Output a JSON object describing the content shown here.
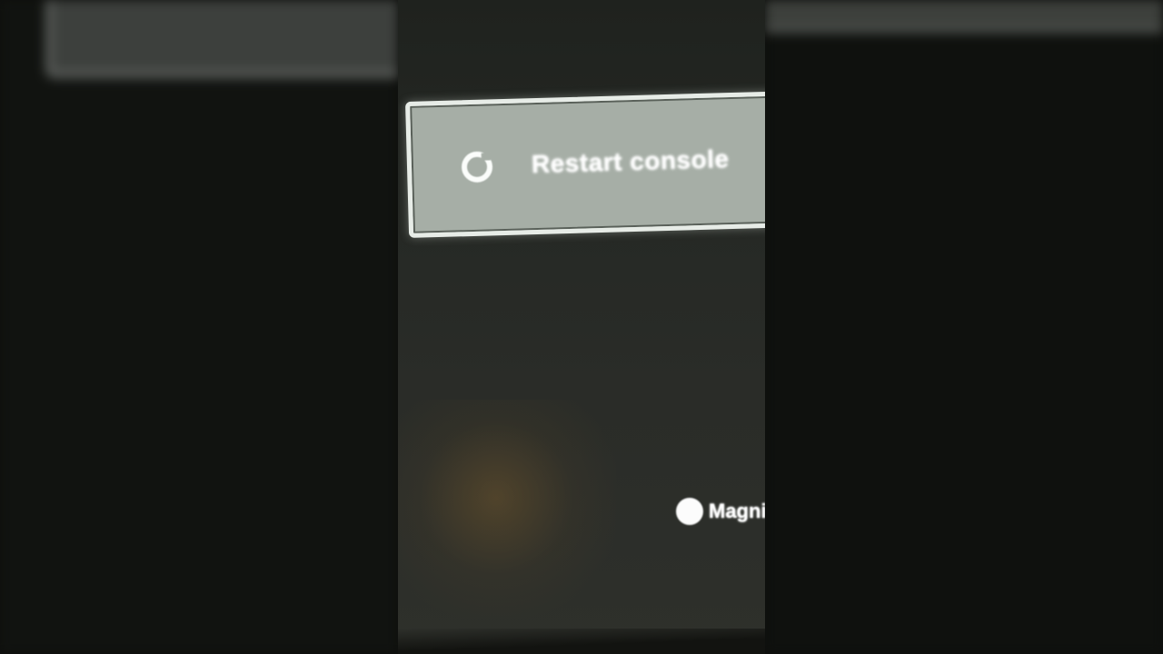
{
  "menu": {
    "restart_label": "Restart console",
    "restart_icon": "restart-icon"
  },
  "hint": {
    "label": "Magni",
    "button_icon": "circle-button-icon"
  },
  "colors": {
    "screen_bg": "#262925",
    "menu_item_bg": "#a6aea6",
    "menu_item_border": "#e7ece7",
    "text": "#ffffff"
  }
}
